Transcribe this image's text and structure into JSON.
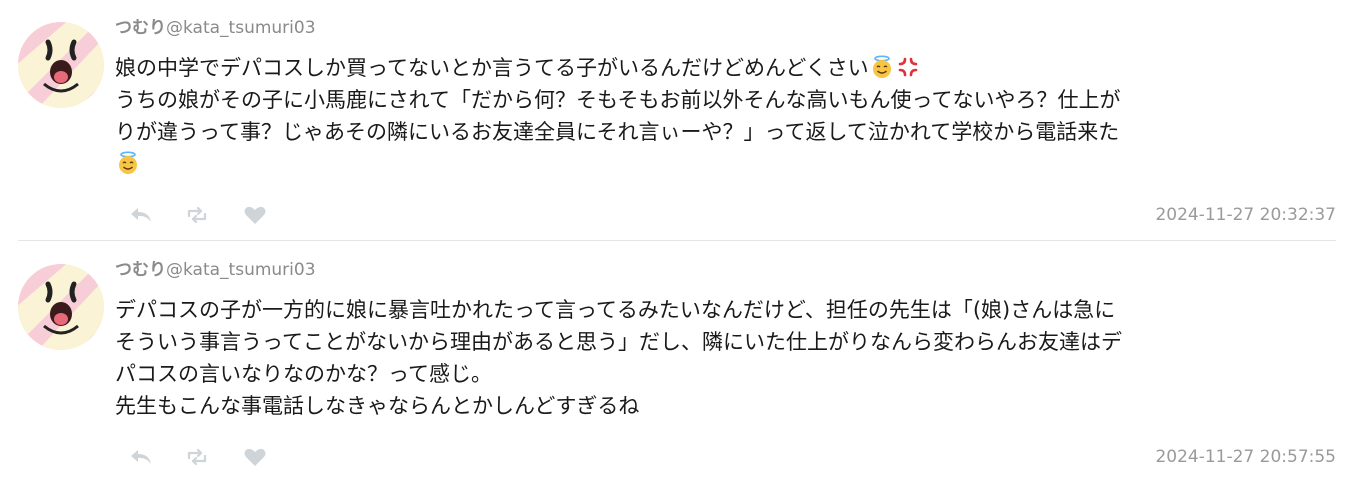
{
  "tweets": [
    {
      "display_name": "つむり",
      "username": "@kata_tsumuri03",
      "avatar_icon": "cartoon-face-avatar",
      "body": {
        "line1_text": "娘の中学でデパコスしか買ってないとか言うてる子がいるんだけどめんどくさい",
        "line1_emojis": [
          "angel-face-emoji",
          "anger-symbol-emoji"
        ],
        "line2": "うちの娘がその子に小馬鹿にされて「だから何？そもそもお前以外そんな高いもん使ってないやろ？仕上が",
        "line3": "りが違うって事？じゃあその隣にいるお友達全員にそれ言ぃーや？」って返して泣かれて学校から電話来た",
        "line4_emojis": [
          "angel-face-emoji"
        ]
      },
      "actions": [
        "reply-icon",
        "retweet-icon",
        "like-icon"
      ],
      "timestamp": "2024-11-27 20:32:37"
    },
    {
      "display_name": "つむり",
      "username": "@kata_tsumuri03",
      "avatar_icon": "cartoon-face-avatar",
      "body": {
        "line1": "デパコスの子が一方的に娘に暴言吐かれたって言ってるみたいなんだけど、担任の先生は「(娘)さんは急に",
        "line2": "そういう事言うってことがないから理由があると思う」だし、隣にいた仕上がりなんら変わらんお友達はデ",
        "line3": "パコスの言いなりなのかな？って感じ。",
        "line4": "先生もこんな事電話しなきゃならんとかしんどすぎるね"
      },
      "actions": [
        "reply-icon",
        "retweet-icon",
        "like-icon"
      ],
      "timestamp": "2024-11-27 20:57:55"
    }
  ],
  "colors": {
    "name": "#8a8a8a",
    "text": "#1a1a1a",
    "timestamp": "#9a9a9a",
    "action_icon": "#cfd4d9",
    "divider": "#e6e6e6"
  }
}
